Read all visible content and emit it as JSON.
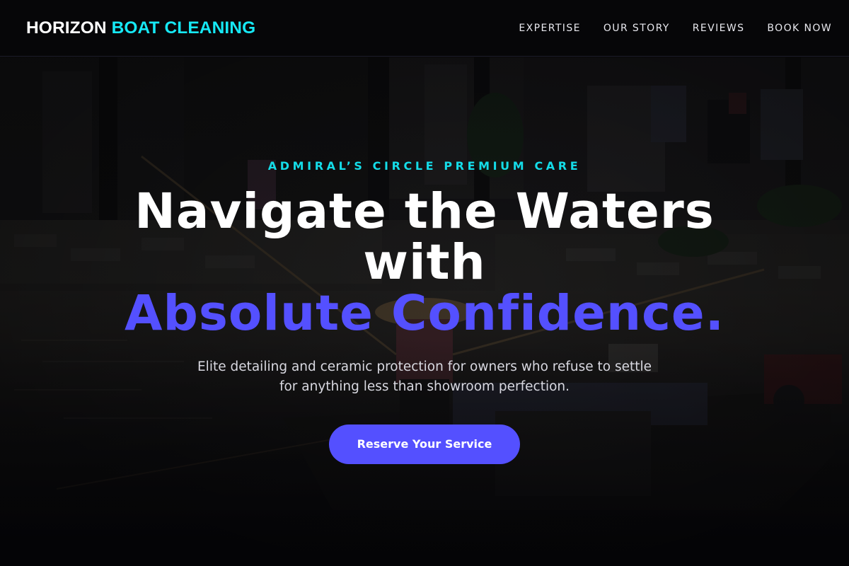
{
  "brand": {
    "primary": "HORIZON",
    "secondary": "BOAT CLEANING"
  },
  "nav": {
    "items": [
      "EXPERTISE",
      "OUR STORY",
      "REVIEWS",
      "BOOK NOW"
    ]
  },
  "hero": {
    "kicker": "ADMIRAL’S CIRCLE PREMIUM CARE",
    "headline_line1": "Navigate the Waters",
    "headline_line2": "with",
    "headline_accent": "Absolute Confidence.",
    "subtitle": "Elite detailing and ceramic protection for owners who refuse to settle for anything less than showroom perfection.",
    "cta_label": "Reserve Your Service",
    "background_image": "canal-boat-photo"
  },
  "colors": {
    "accent": "#5450ff",
    "highlight": "#16e8f5",
    "background": "#060608"
  }
}
